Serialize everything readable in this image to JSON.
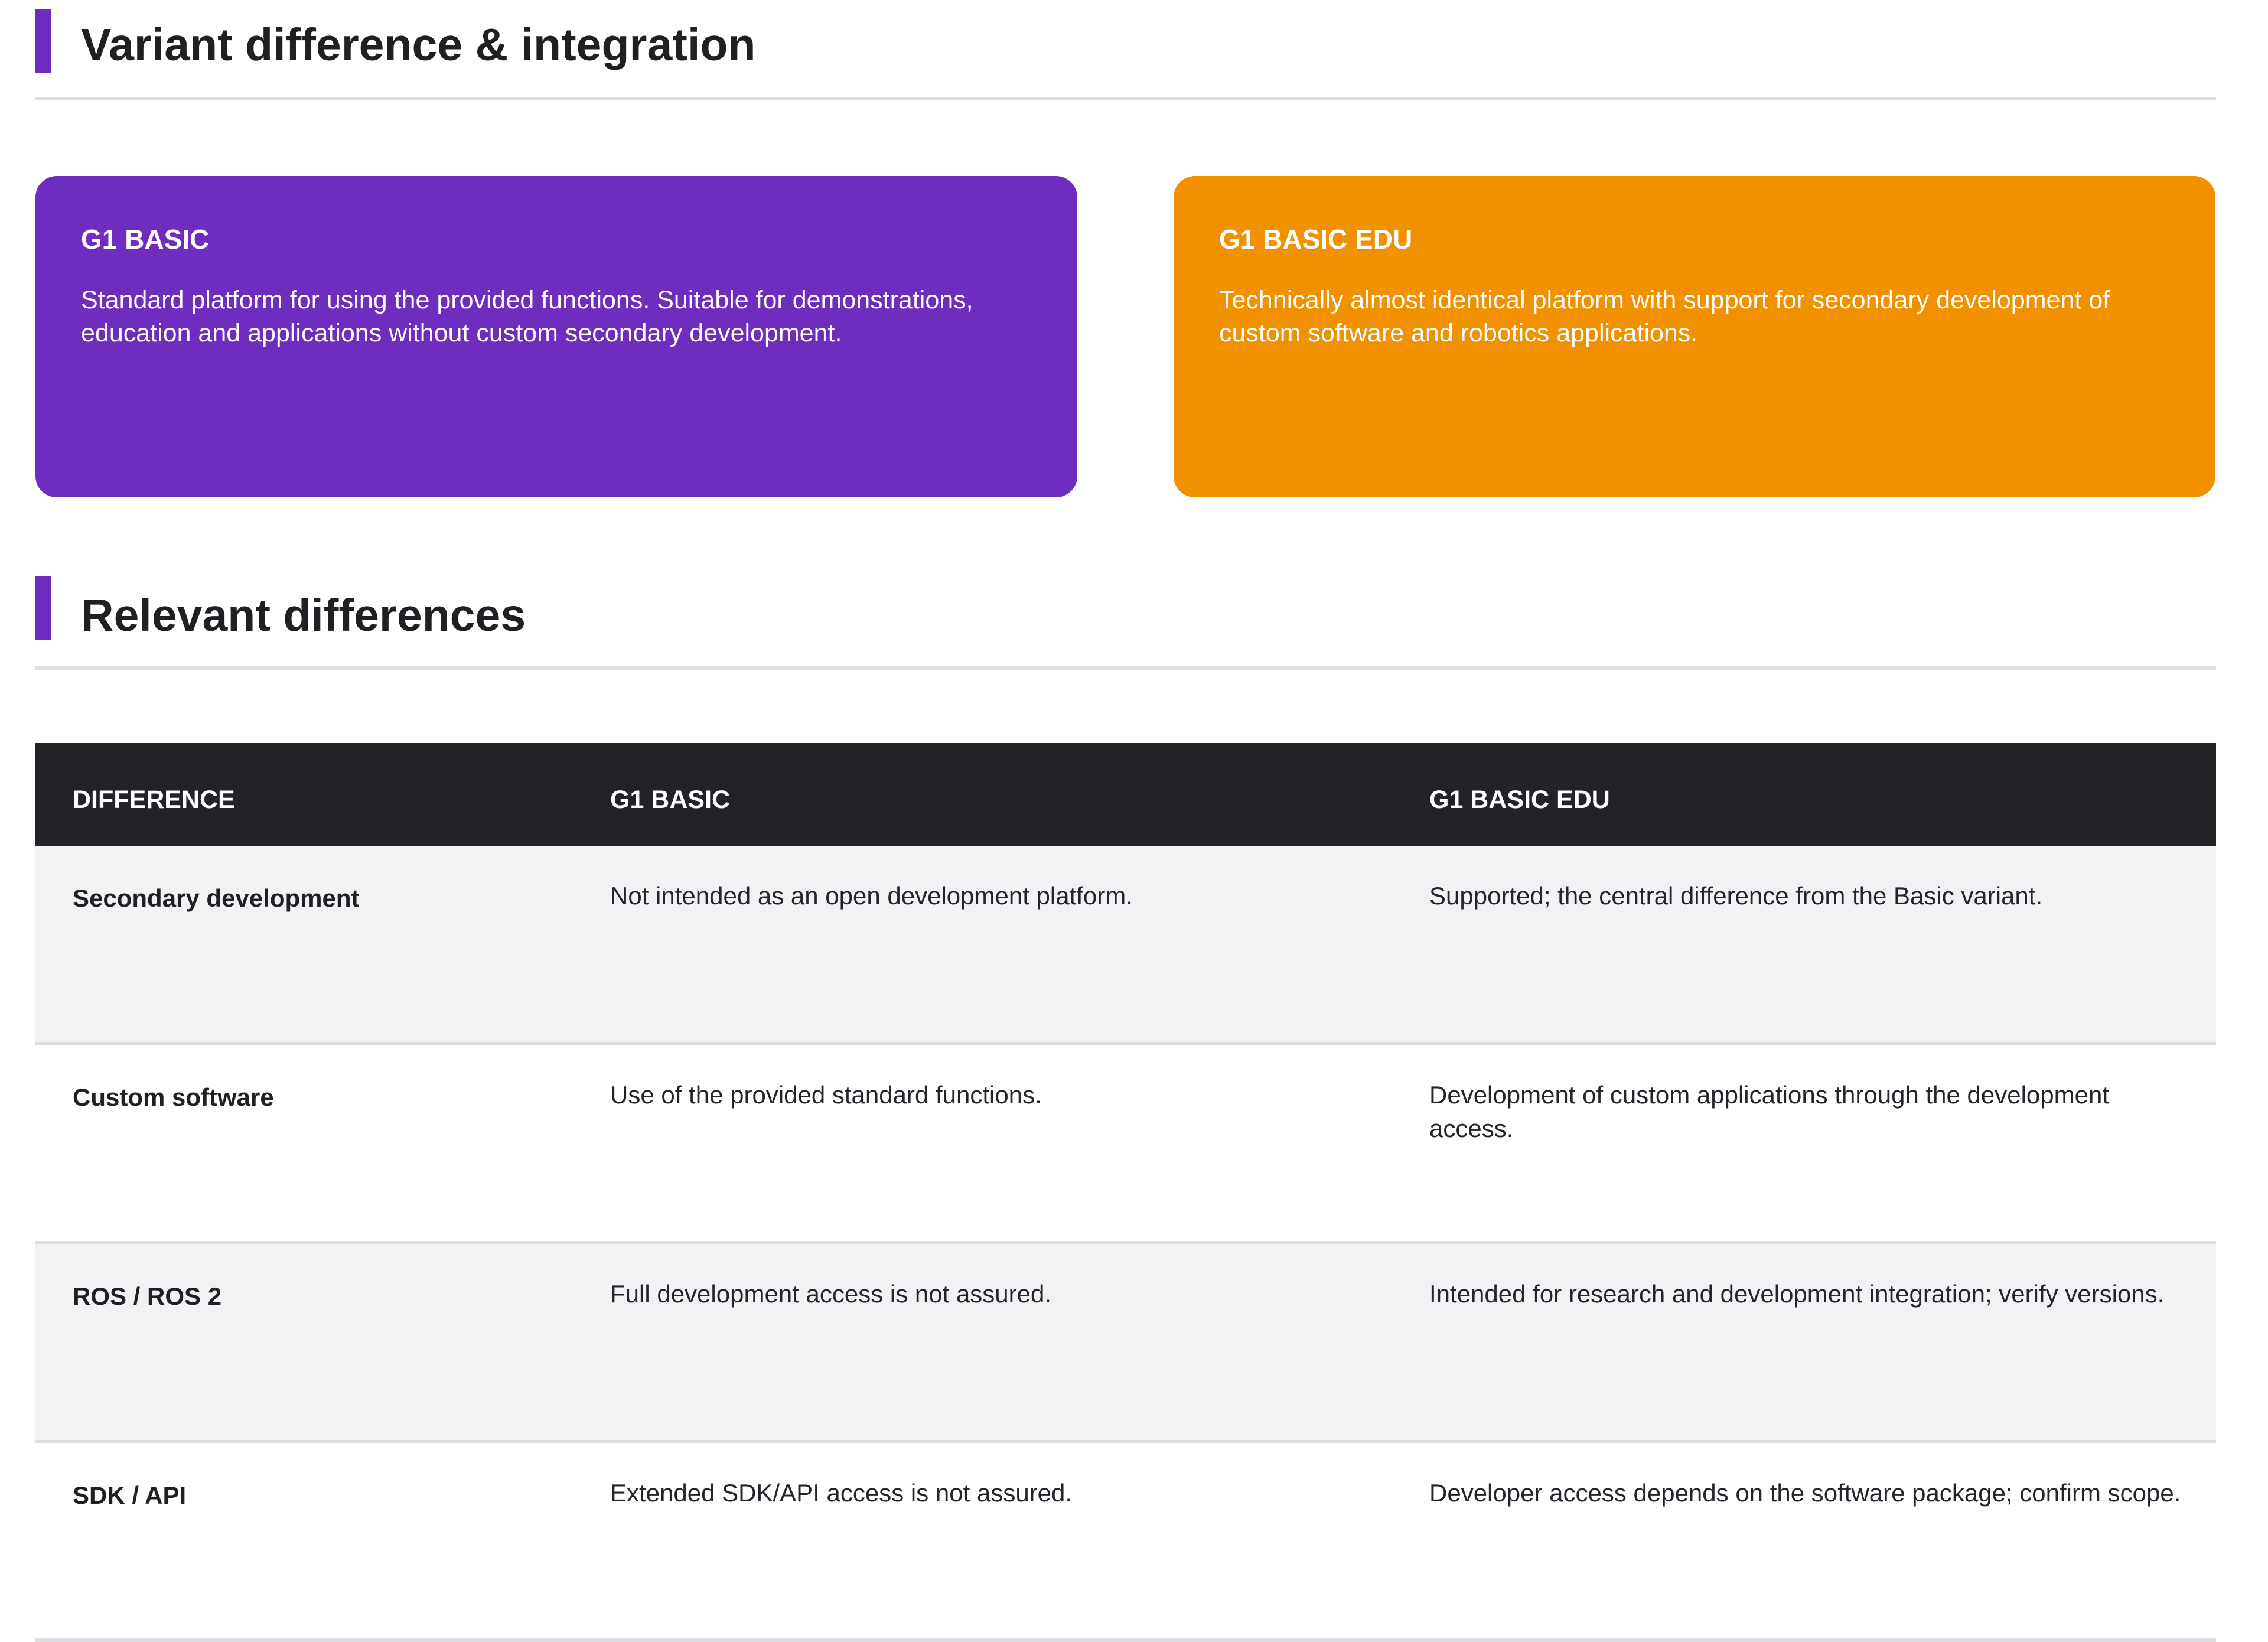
{
  "sections": {
    "variant_heading": "Variant difference & integration",
    "differences_heading": "Relevant differences"
  },
  "cards": [
    {
      "title": "G1 BASIC",
      "text": "Standard platform for using the provided functions. Suitable for demonstrations, education and applications without custom secondary development.",
      "color": "#6E2DBF"
    },
    {
      "title": "G1 BASIC EDU",
      "text": "Technically almost identical platform with support for secondary development of custom software and robotics applications.",
      "color": "#F29100"
    }
  ],
  "table": {
    "headers": [
      "DIFFERENCE",
      "G1 BASIC",
      "G1 BASIC EDU"
    ],
    "rows": [
      {
        "difference": "Secondary development",
        "basic": "Not intended as an open development platform.",
        "edu": "Supported; the central difference from the Basic variant."
      },
      {
        "difference": "Custom software",
        "basic": "Use of the provided standard functions.",
        "edu": "Development of custom applications through the development access."
      },
      {
        "difference": "ROS / ROS 2",
        "basic": "Full development access is not assured.",
        "edu": "Intended for research and development integration; verify versions."
      },
      {
        "difference": "SDK / API",
        "basic": "Extended SDK/API access is not assured.",
        "edu": "Developer access depends on the software package; confirm scope."
      }
    ]
  },
  "colors": {
    "accent": "#6E2DBF",
    "table_header_bg": "#222227",
    "row_shade": "#F2F2F4"
  }
}
